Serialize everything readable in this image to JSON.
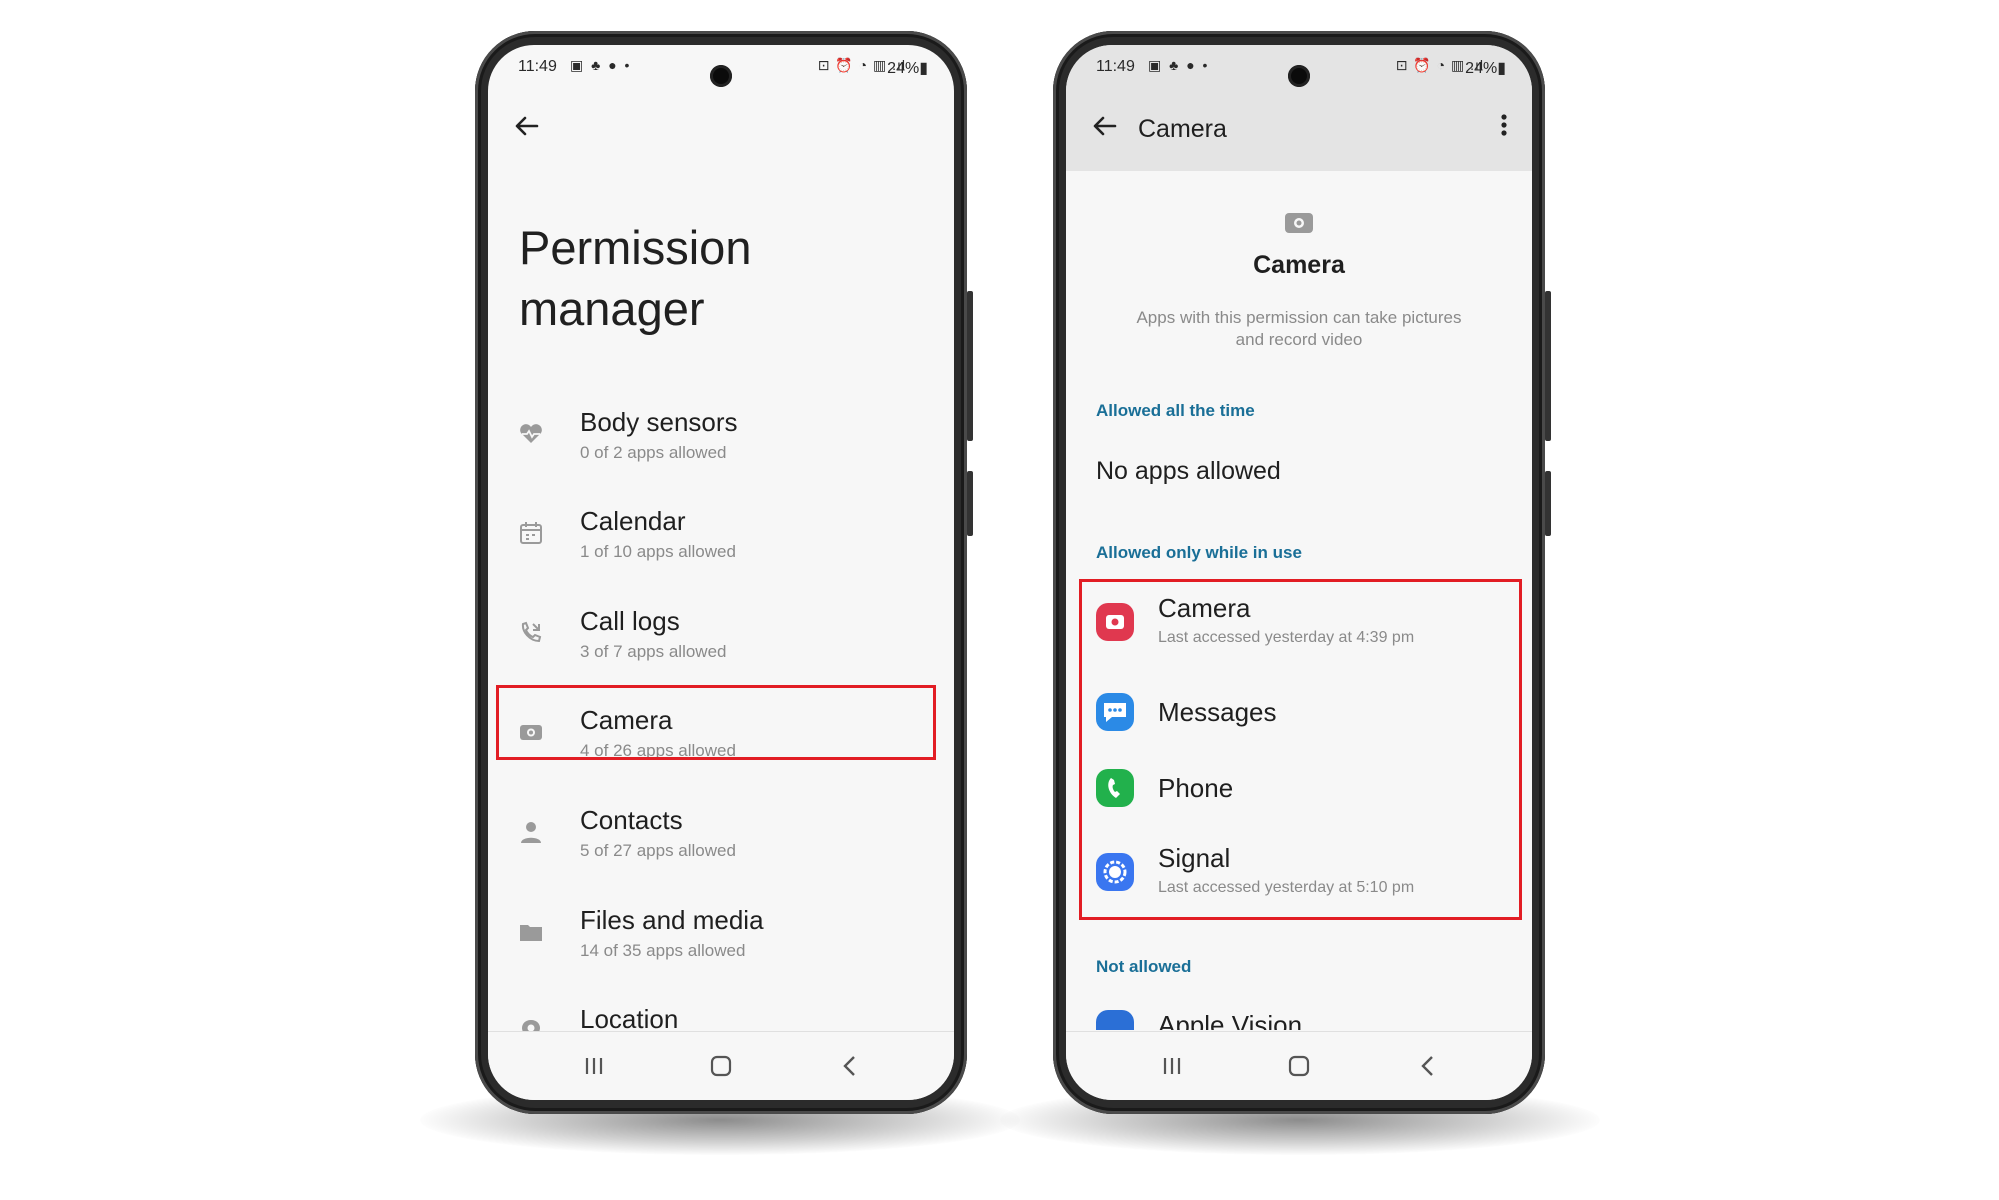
{
  "left_phone": {
    "status": {
      "time": "11:49",
      "left_icons": "▣ ♣ ● •",
      "right_icons": "⊡ ⏰ ◔ ▥ .ıl",
      "battery": "24%▮"
    },
    "title": "Permission manager",
    "items": [
      {
        "icon": "heart-pulse-icon",
        "label": "Body sensors",
        "sub": "0 of 2 apps allowed"
      },
      {
        "icon": "calendar-icon",
        "label": "Calendar",
        "sub": "1 of 10 apps allowed"
      },
      {
        "icon": "call-log-icon",
        "label": "Call logs",
        "sub": "3 of 7 apps allowed"
      },
      {
        "icon": "camera-icon",
        "label": "Camera",
        "sub": "4 of 26 apps allowed"
      },
      {
        "icon": "person-icon",
        "label": "Contacts",
        "sub": "5 of 27 apps allowed"
      },
      {
        "icon": "folder-icon",
        "label": "Files and media",
        "sub": "14 of 35 apps allowed"
      },
      {
        "icon": "location-icon",
        "label": "Location",
        "sub": ""
      }
    ]
  },
  "right_phone": {
    "status": {
      "time": "11:49",
      "left_icons": "▣ ♣ ● •",
      "right_icons": "⊡ ⏰ ◔ ▥ .ıl",
      "battery": "24%▮"
    },
    "appbar_title": "Camera",
    "header_title": "Camera",
    "header_desc": "Apps with this permission can take pictures and record video",
    "section_always": "Allowed all the time",
    "no_apps": "No apps allowed",
    "section_in_use": "Allowed only while in use",
    "apps": [
      {
        "icon": "camera-app-icon",
        "label": "Camera",
        "sub": "Last accessed yesterday at 4:39 pm",
        "color": "#e0384f"
      },
      {
        "icon": "messages-app-icon",
        "label": "Messages",
        "sub": "",
        "color": "#2b8ae6"
      },
      {
        "icon": "phone-app-icon",
        "label": "Phone",
        "sub": "",
        "color": "#22b14c"
      },
      {
        "icon": "signal-app-icon",
        "label": "Signal",
        "sub": "Last accessed yesterday at 5:10 pm",
        "color": "#3a76f0"
      }
    ],
    "section_not_allowed": "Not allowed",
    "partial_app": "Apple Vision"
  },
  "colors": {
    "highlight": "#e21d24",
    "section_blue": "#1a6f97"
  }
}
